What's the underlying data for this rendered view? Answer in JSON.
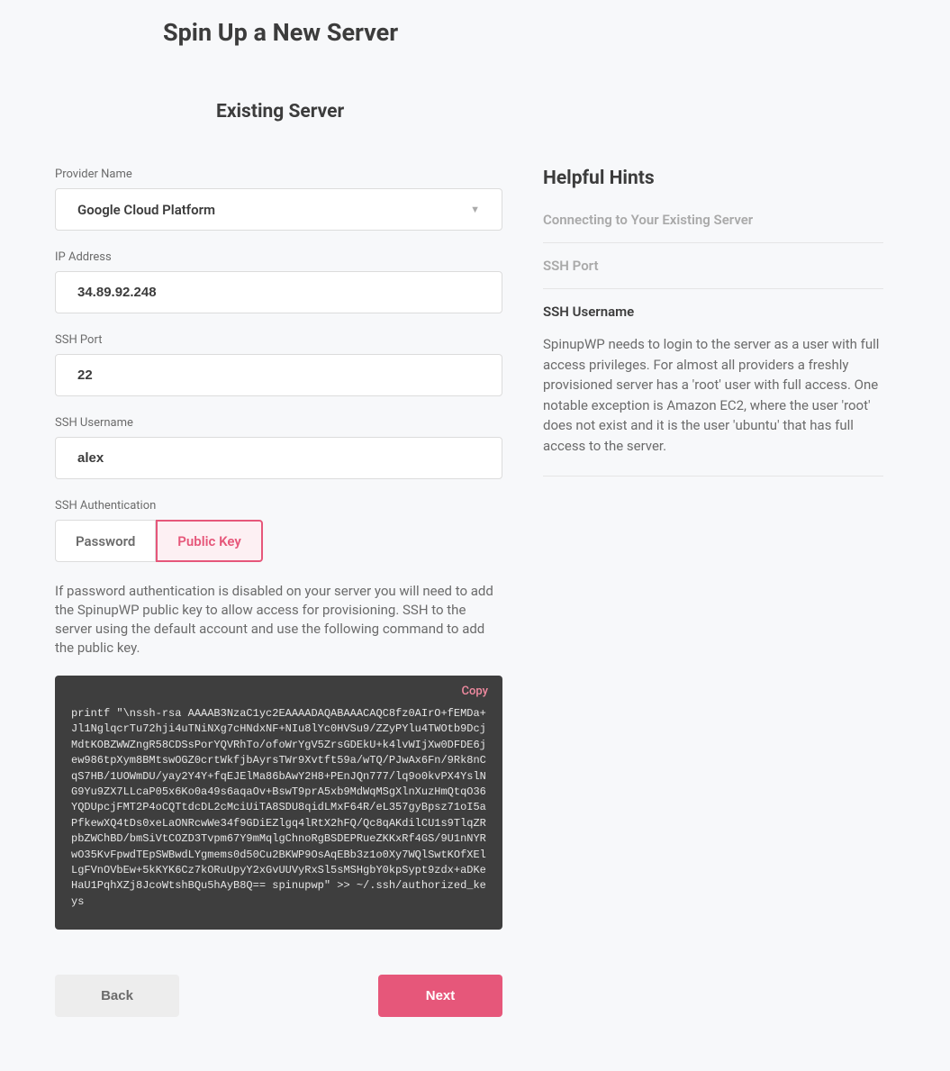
{
  "page_title": "Spin Up a New Server",
  "sub_title": "Existing Server",
  "form": {
    "provider_label": "Provider Name",
    "provider_value": "Google Cloud Platform",
    "ip_label": "IP Address",
    "ip_value": "34.89.92.248",
    "port_label": "SSH Port",
    "port_value": "22",
    "user_label": "SSH Username",
    "user_value": "alex",
    "auth_label": "SSH Authentication",
    "auth_password": "Password",
    "auth_public_key": "Public Key",
    "help_text": "If password authentication is disabled on your server you will need to add the SpinupWP public key to allow access for provisioning. SSH to the server using the default account and use the following command to add the public key.",
    "copy_label": "Copy",
    "ssh_command": "printf \"\\nssh-rsa AAAAB3NzaC1yc2EAAAADAQABAAACAQC8fz0AIrO+fEMDa+Jl1NglqcrTu72hji4uTNiNXg7cHNdxNF+NIu8lYc0HVSu9/ZZyPYlu4TWOtb9DcjMdtKOBZWWZngR58CDSsPorYQVRhTo/ofoWrYgV5ZrsGDEkU+k4lvWIjXw0DFDE6jew986tpXym8BMtswOGZ0crtWkfjbAyrsTWr9Xvtft59a/wTQ/PJwAx6Fn/9Rk8nCqS7HB/1UOWmDU/yay2Y4Y+fqEJElMa86bAwY2H8+PEnJQn777/lq9o0kvPX4YslNG9Yu9ZX7LLcaP05x6Ko0a49s6aqaOv+BswT9prA5xb9MdWqMSgXlnXuzHmQtqO36YQDUpcjFMT2P4oCQTtdcDL2cMciUiTA8SDU8qidLMxF64R/eL357gyBpsz71oI5aPfkewXQ4tDs0xeLaONRcwWe34f9GDiEZlgq4lRtX2hFQ/Qc8qAKdilCU1s9TlqZRpbZWChBD/bmSiVtCOZD3Tvpm67Y9mMqlgChnoRgBSDEPRueZKKxRf4GS/9U1nNYRwO35KvFpwdTEpSWBwdLYgmems0d50Cu2BKWP9OsAqEBb3z1o0Xy7WQlSwtKOfXElLgFVnOVbEw+5kKYK6Cz7kORuUpyY2xGvUUVyRxSl5sMSHgbY0kpSypt9zdx+aDKeHaU1PqhXZj8JcoWtshBQu5hAyB8Q== spinupwp\" >> ~/.ssh/authorized_keys"
  },
  "nav": {
    "back": "Back",
    "next": "Next"
  },
  "hints": {
    "title": "Helpful Hints",
    "items": [
      {
        "label": "Connecting to Your Existing Server"
      },
      {
        "label": "SSH Port"
      },
      {
        "label": "SSH Username"
      }
    ],
    "active_body": "SpinupWP needs to login to the server as a user with full access privileges. For almost all providers a freshly provisioned server has a 'root' user with full access. One notable exception is Amazon EC2, where the user 'root' does not exist and it is the user 'ubuntu' that has full access to the server."
  }
}
